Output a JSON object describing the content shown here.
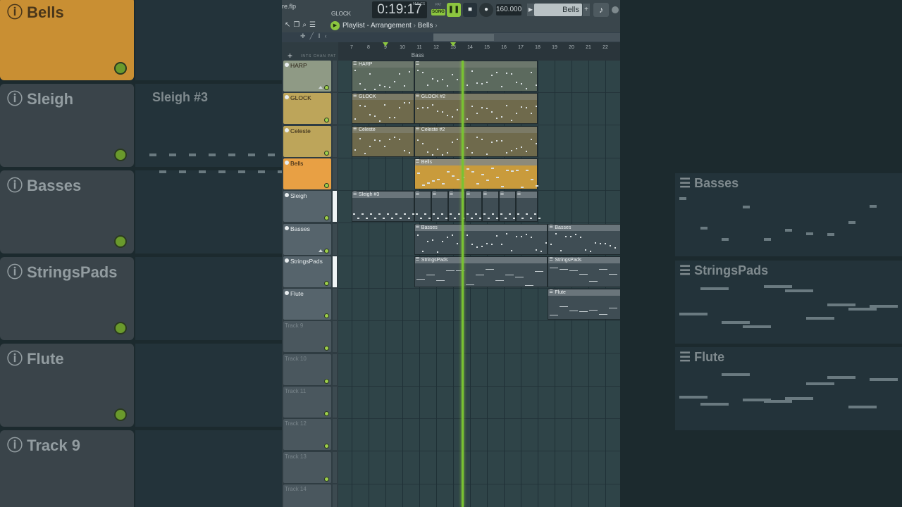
{
  "background": {
    "left_tracks": [
      "Bells",
      "Sleigh",
      "Basses",
      "StringsPads",
      "Flute",
      "Track 9"
    ],
    "left_clip_label": "Sleigh #3",
    "right_clip_labels": [
      "Basses",
      "StringsPads",
      "Flute"
    ]
  },
  "topbar": {
    "file_name": "re.flp",
    "channel": "GLOCK",
    "time": "0:19:17",
    "time_unit": "M:S:CS",
    "pat_label": "PAT",
    "song_label": "SONG",
    "play_icon": "pause-icon",
    "stop_icon": "stop-icon",
    "record_icon": "record-icon",
    "bpm": "160.000",
    "pattern_name": "Bells",
    "pattern_arrow": "▶",
    "pattern_plus": "+"
  },
  "titlebar": {
    "title": "Playlist - Arrangement",
    "breadcrumb": "Bells",
    "crumb_arrow": "›",
    "icons": "↖❐⌕☰"
  },
  "toolbar2": {
    "icons": "✚╱‖‹"
  },
  "ruler": {
    "bars": [
      "7",
      "8",
      "9",
      "10",
      "11",
      "12",
      "13",
      "14",
      "15",
      "16",
      "17",
      "18",
      "19",
      "20",
      "21",
      "22"
    ],
    "marker_label": "Bass",
    "add_label": "+",
    "tabs": "INTS CHAN PAT"
  },
  "tracks": [
    {
      "name": "HARP",
      "style": "harp"
    },
    {
      "name": "GLOCK",
      "style": "gold"
    },
    {
      "name": "Celeste",
      "style": "gold"
    },
    {
      "name": "Bells",
      "style": "bells"
    },
    {
      "name": "Sleigh",
      "style": "plain"
    },
    {
      "name": "Basses",
      "style": "plain"
    },
    {
      "name": "StringsPads",
      "style": "plain"
    },
    {
      "name": "Flute",
      "style": "plain"
    },
    {
      "name": "Track 9",
      "style": "empty"
    },
    {
      "name": "Track 10",
      "style": "empty"
    },
    {
      "name": "Track 11",
      "style": "empty"
    },
    {
      "name": "Track 12",
      "style": "empty"
    },
    {
      "name": "Track 13",
      "style": "empty"
    },
    {
      "name": "Track 14",
      "style": "empty"
    }
  ],
  "clips": [
    {
      "label": "HARP",
      "track": 0,
      "start": 7,
      "end": 10.7,
      "style": "harp"
    },
    {
      "label": "",
      "track": 0,
      "start": 10.7,
      "end": 18,
      "style": "harp"
    },
    {
      "label": "GLOCK",
      "track": 1,
      "start": 7,
      "end": 10.7,
      "style": "gold"
    },
    {
      "label": "GLOCK #2",
      "track": 1,
      "start": 10.7,
      "end": 18,
      "style": "gold"
    },
    {
      "label": "Celeste",
      "track": 2,
      "start": 7,
      "end": 10.7,
      "style": "gold"
    },
    {
      "label": "Celeste #2",
      "track": 2,
      "start": 10.7,
      "end": 18,
      "style": "gold"
    },
    {
      "label": "Bells",
      "track": 3,
      "start": 10.7,
      "end": 18,
      "style": "bells"
    },
    {
      "label": "Sleigh #3",
      "track": 4,
      "start": 7,
      "end": 10.7,
      "style": "grey"
    },
    {
      "label": "",
      "track": 4,
      "start": 10.7,
      "end": 11.7,
      "style": "grey"
    },
    {
      "label": "",
      "track": 4,
      "start": 11.7,
      "end": 12.7,
      "style": "grey"
    },
    {
      "label": "",
      "track": 4,
      "start": 12.7,
      "end": 13.7,
      "style": "grey"
    },
    {
      "label": "",
      "track": 4,
      "start": 13.7,
      "end": 14.7,
      "style": "grey"
    },
    {
      "label": "",
      "track": 4,
      "start": 14.7,
      "end": 15.7,
      "style": "grey"
    },
    {
      "label": "",
      "track": 4,
      "start": 15.7,
      "end": 16.7,
      "style": "grey"
    },
    {
      "label": "",
      "track": 4,
      "start": 16.7,
      "end": 18,
      "style": "grey"
    },
    {
      "label": "Basses",
      "track": 5,
      "start": 10.7,
      "end": 18.6,
      "style": "grey"
    },
    {
      "label": "Basses",
      "track": 5,
      "start": 18.6,
      "end": 24,
      "style": "grey"
    },
    {
      "label": "StringsPads",
      "track": 6,
      "start": 10.7,
      "end": 18.6,
      "style": "grey"
    },
    {
      "label": "StringsPads",
      "track": 6,
      "start": 18.6,
      "end": 24,
      "style": "grey"
    },
    {
      "label": "Flute",
      "track": 7,
      "start": 18.6,
      "end": 24,
      "style": "grey"
    }
  ],
  "colors": {
    "accent": "#8cc63f",
    "playhead": "#79c232",
    "bells": "#e8a044"
  }
}
